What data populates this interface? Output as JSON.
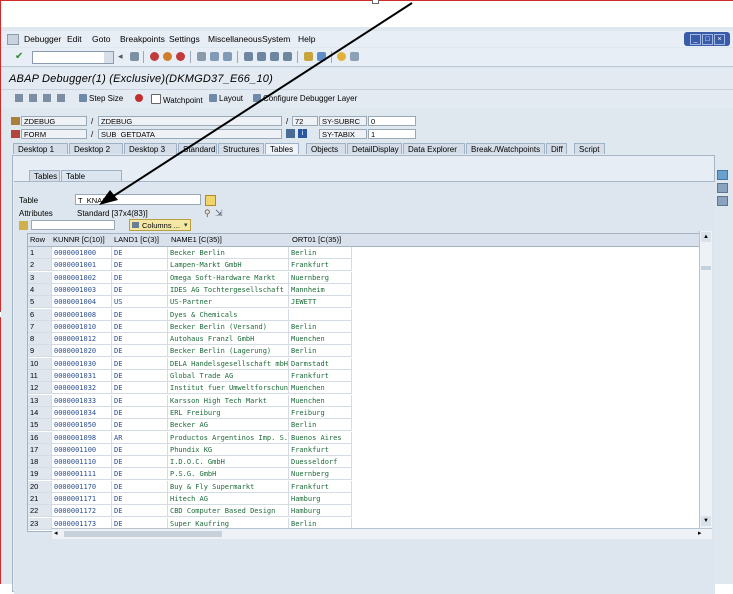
{
  "menu": [
    "Debugger",
    "Edit",
    "Goto",
    "Breakpoints",
    "Settings",
    "Miscellaneous",
    "System",
    "Help"
  ],
  "menu_underline": [
    "D",
    "E",
    "G",
    "B",
    "S",
    "M",
    "y",
    "H"
  ],
  "title": "ABAP Debugger(1)  (Exclusive)(DKMGD37_E66_10)",
  "app_toolbar": {
    "step_size": "Step Size",
    "watchpoint": "Watchpoint",
    "layout": "Layout",
    "configure": "Configure Debugger Layer"
  },
  "context": {
    "row1": {
      "f1": "ZDEBUG",
      "slash1": "/",
      "f2": "ZDEBUG",
      "slash2": "/",
      "line": "72",
      "sysname": "SY-SUBRC",
      "sysval": "0"
    },
    "row2": {
      "f1": "FORM",
      "slash1": "/",
      "f2": "SUB_GETDATA",
      "sysname": "SY-TABIX",
      "sysval": "1"
    }
  },
  "tabs": [
    "Desktop 1",
    "Desktop 2",
    "Desktop 3",
    "Standard",
    "Structures",
    "Tables",
    "Objects",
    "DetailDisplay",
    "Data Explorer",
    "Break./Watchpoints",
    "Diff",
    "Script"
  ],
  "active_tab": "Tables",
  "subtabs": [
    "Tables",
    "Table Contents"
  ],
  "table_label": "Table",
  "table_value": "T_KNA1",
  "attributes_label": "Attributes",
  "attributes_value": "Standard [37x4(83)]",
  "columns_button": "Columns ...",
  "grid": {
    "headers": [
      "Row",
      "KUNNR [C(10)]",
      "LAND1 [C(3)]",
      "NAME1 [C(35)]",
      "ORT01 [C(35)]"
    ],
    "rows": [
      [
        "1",
        "0000001000",
        "DE",
        "Becker Berlin",
        "Berlin"
      ],
      [
        "2",
        "0000001001",
        "DE",
        "Lampen-Markt GmbH",
        "Frankfurt"
      ],
      [
        "3",
        "0000001002",
        "DE",
        "Omega Soft-Hardware Markt",
        "Nuernberg"
      ],
      [
        "4",
        "0000001003",
        "DE",
        "IDES AG Tochtergesellschaft",
        "Mannheim"
      ],
      [
        "5",
        "0000001004",
        "US",
        "US-Partner",
        "JEWETT"
      ],
      [
        "6",
        "0000001008",
        "DE",
        "Dyes & Chemicals",
        ""
      ],
      [
        "7",
        "0000001010",
        "DE",
        "Becker Berlin (Versand)",
        "Berlin"
      ],
      [
        "8",
        "0000001012",
        "DE",
        "Autohaus Franzl GmbH",
        "Muenchen"
      ],
      [
        "9",
        "0000001020",
        "DE",
        "Becker Berlin (Lagerung)",
        "Berlin"
      ],
      [
        "10",
        "0000001030",
        "DE",
        "DELA Handelsgesellschaft mbH",
        "Darmstadt"
      ],
      [
        "11",
        "0000001031",
        "DE",
        "Global Trade AG",
        "Frankfurt"
      ],
      [
        "12",
        "0000001032",
        "DE",
        "Institut fuer Umweltforschung",
        "Muenchen"
      ],
      [
        "13",
        "0000001033",
        "DE",
        "Karsson High Tech Markt",
        "Muenchen"
      ],
      [
        "14",
        "0000001034",
        "DE",
        "ERL Freiburg",
        "Freiburg"
      ],
      [
        "15",
        "0000001050",
        "DE",
        "Becker AG",
        "Berlin"
      ],
      [
        "16",
        "0000001098",
        "AR",
        "Productos Argentinos Imp. S.A",
        "Buenos Aires"
      ],
      [
        "17",
        "0000001100",
        "DE",
        "Phundix KG",
        "Frankfurt"
      ],
      [
        "18",
        "0000001110",
        "DE",
        "I.D.O.C. GmbH",
        "Duesseldorf"
      ],
      [
        "19",
        "0000001111",
        "DE",
        "P.S.G. GmbH",
        "Nuernberg"
      ],
      [
        "20",
        "0000001170",
        "DE",
        "Buy & Fly Supermarkt",
        "Frankfurt"
      ],
      [
        "21",
        "0000001171",
        "DE",
        "Hitech AG",
        "Hamburg"
      ],
      [
        "22",
        "0000001172",
        "DE",
        "CBD Computer Based Design",
        "Hamburg"
      ],
      [
        "23",
        "0000001173",
        "DE",
        "Super Kaufring",
        "Berlin"
      ]
    ]
  }
}
